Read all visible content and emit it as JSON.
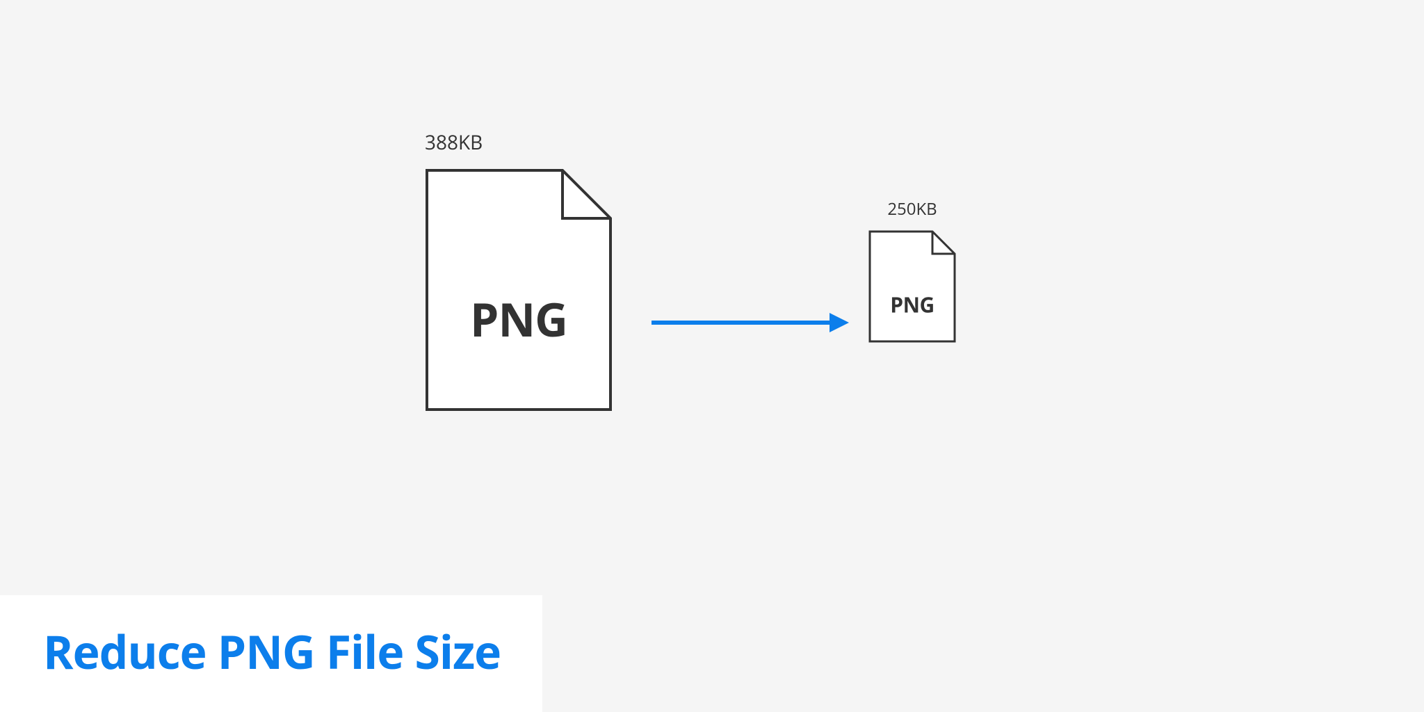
{
  "diagram": {
    "large_file": {
      "size_label": "388KB",
      "format_label": "PNG"
    },
    "small_file": {
      "size_label": "250KB",
      "format_label": "PNG"
    },
    "title": "Reduce PNG File Size",
    "colors": {
      "arrow": "#0c7eeb",
      "title": "#0c7eeb",
      "stroke": "#333333"
    }
  }
}
